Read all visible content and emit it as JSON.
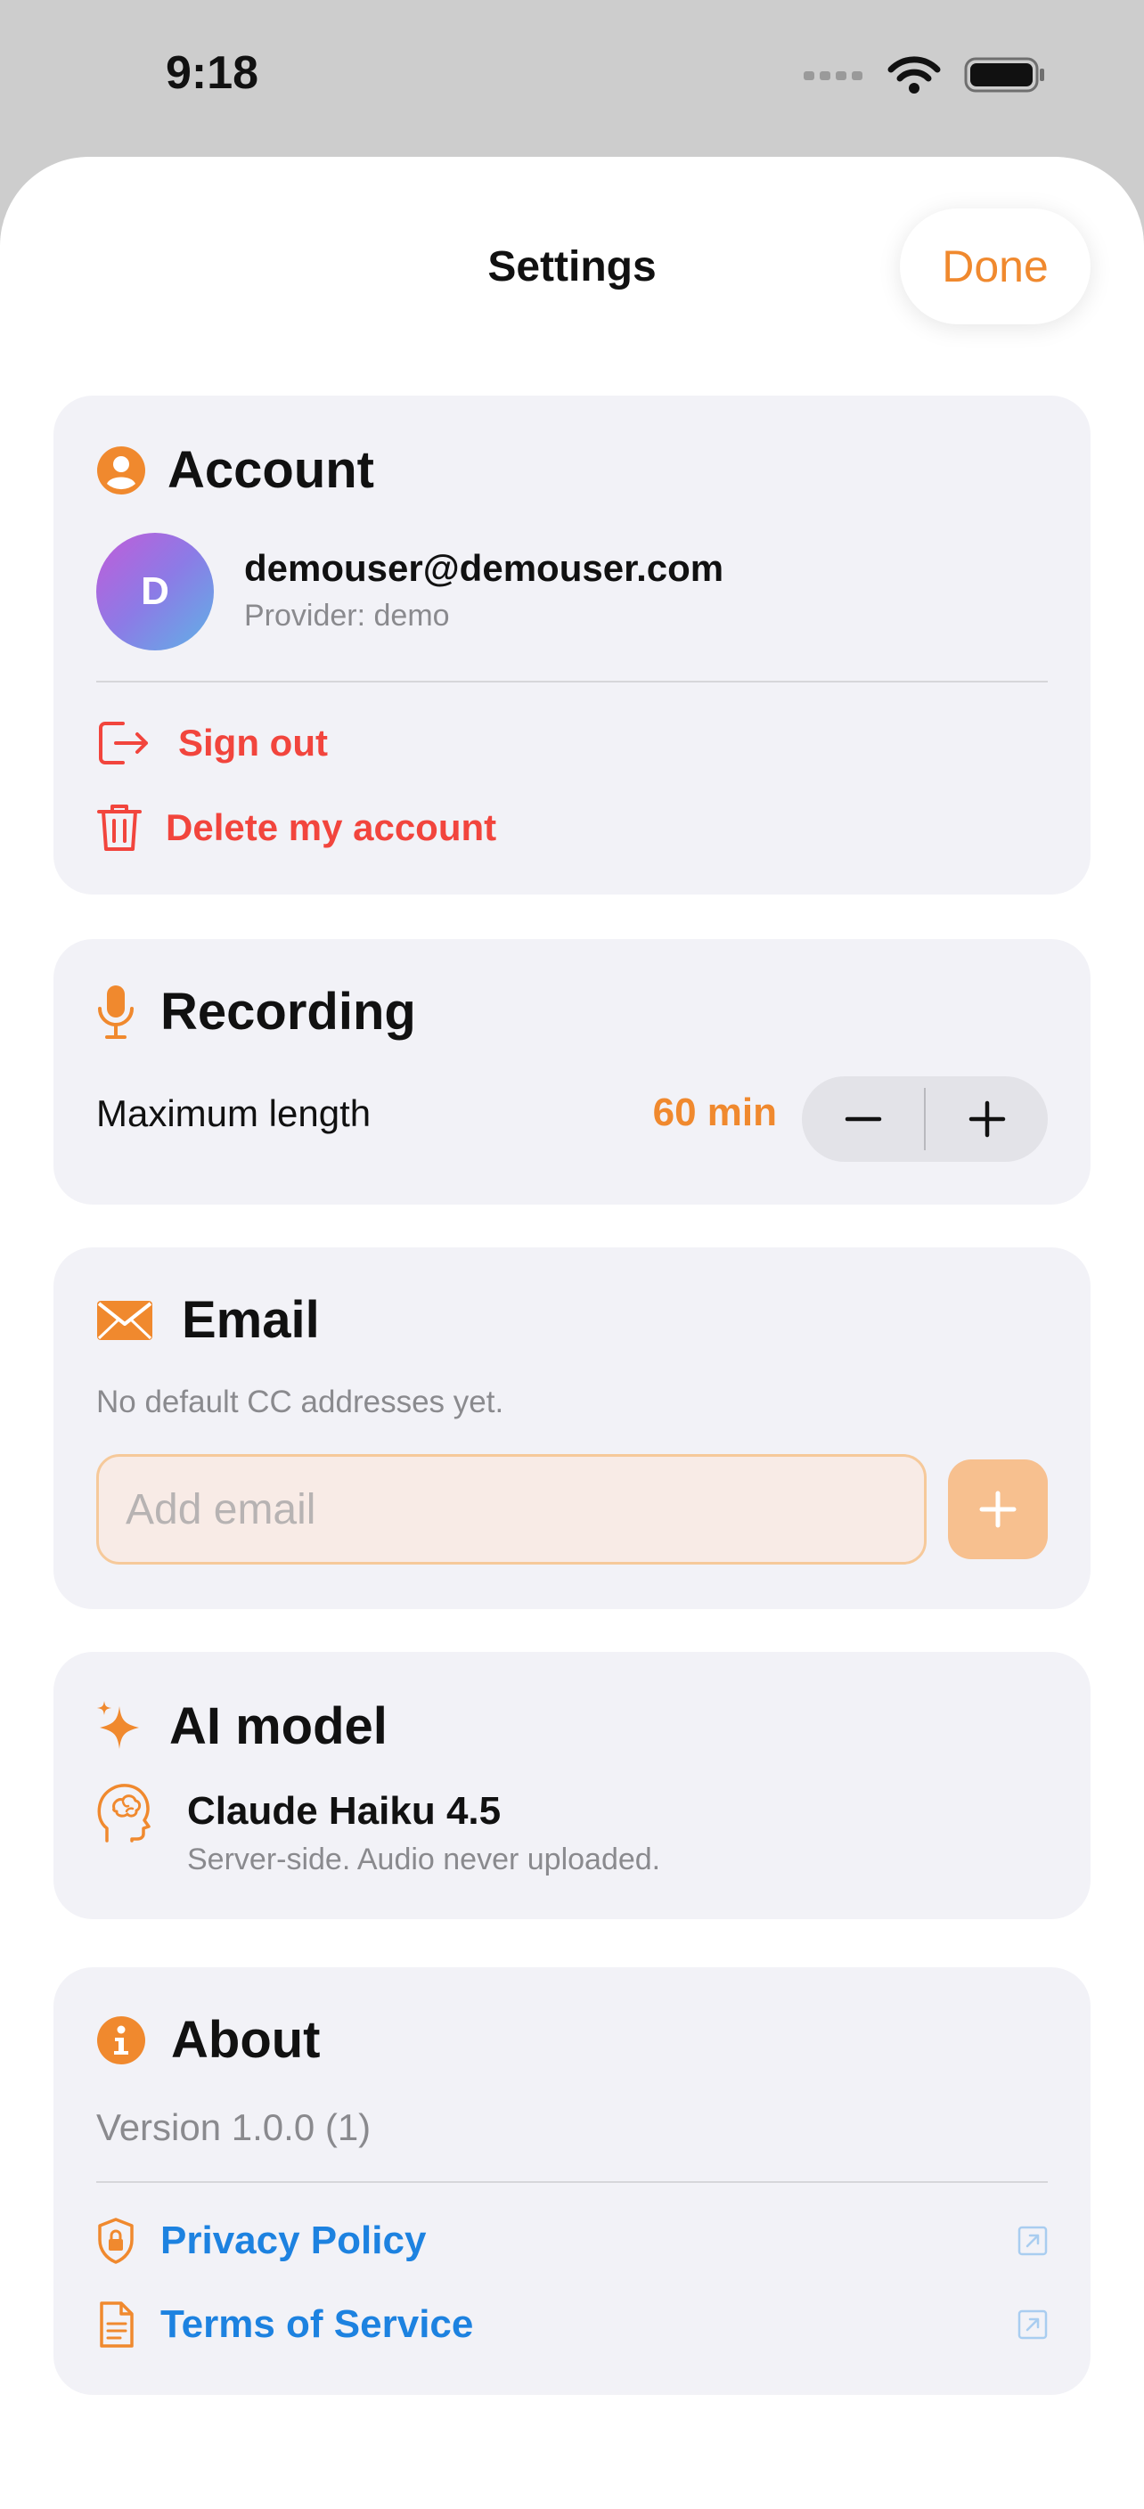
{
  "status_bar": {
    "time": "9:18"
  },
  "nav": {
    "title": "Settings",
    "done_label": "Done"
  },
  "account": {
    "title": "Account",
    "avatar_initial": "D",
    "email": "demouser@demouser.com",
    "provider": "Provider: demo",
    "sign_out_label": "Sign out",
    "delete_label": "Delete my account"
  },
  "recording": {
    "title": "Recording",
    "max_length_label": "Maximum length",
    "max_length_value": "60 min",
    "decrement_symbol": "−",
    "increment_symbol": "+"
  },
  "email": {
    "title": "Email",
    "hint": "No default CC addresses yet.",
    "input_placeholder": "Add email",
    "input_value": ""
  },
  "ai_model": {
    "title": "AI model",
    "model_name": "Claude Haiku 4.5",
    "model_desc": "Server-side. Audio never uploaded."
  },
  "about": {
    "title": "About",
    "version": "Version 1.0.0 (1)",
    "privacy_label": "Privacy Policy",
    "terms_label": "Terms of Service"
  },
  "colors": {
    "accent": "#f0892e",
    "danger": "#f2453d",
    "link": "#1d82e0",
    "card_bg": "#f2f2f7"
  },
  "icons": {
    "account": "person-circle-icon",
    "sign_out": "sign-out-icon",
    "delete": "trash-icon",
    "recording": "microphone-icon",
    "email": "envelope-icon",
    "ai": "sparkles-icon",
    "model": "brain-head-icon",
    "about": "info-circle-icon",
    "privacy": "shield-lock-icon",
    "terms": "document-icon",
    "external": "external-link-icon"
  }
}
